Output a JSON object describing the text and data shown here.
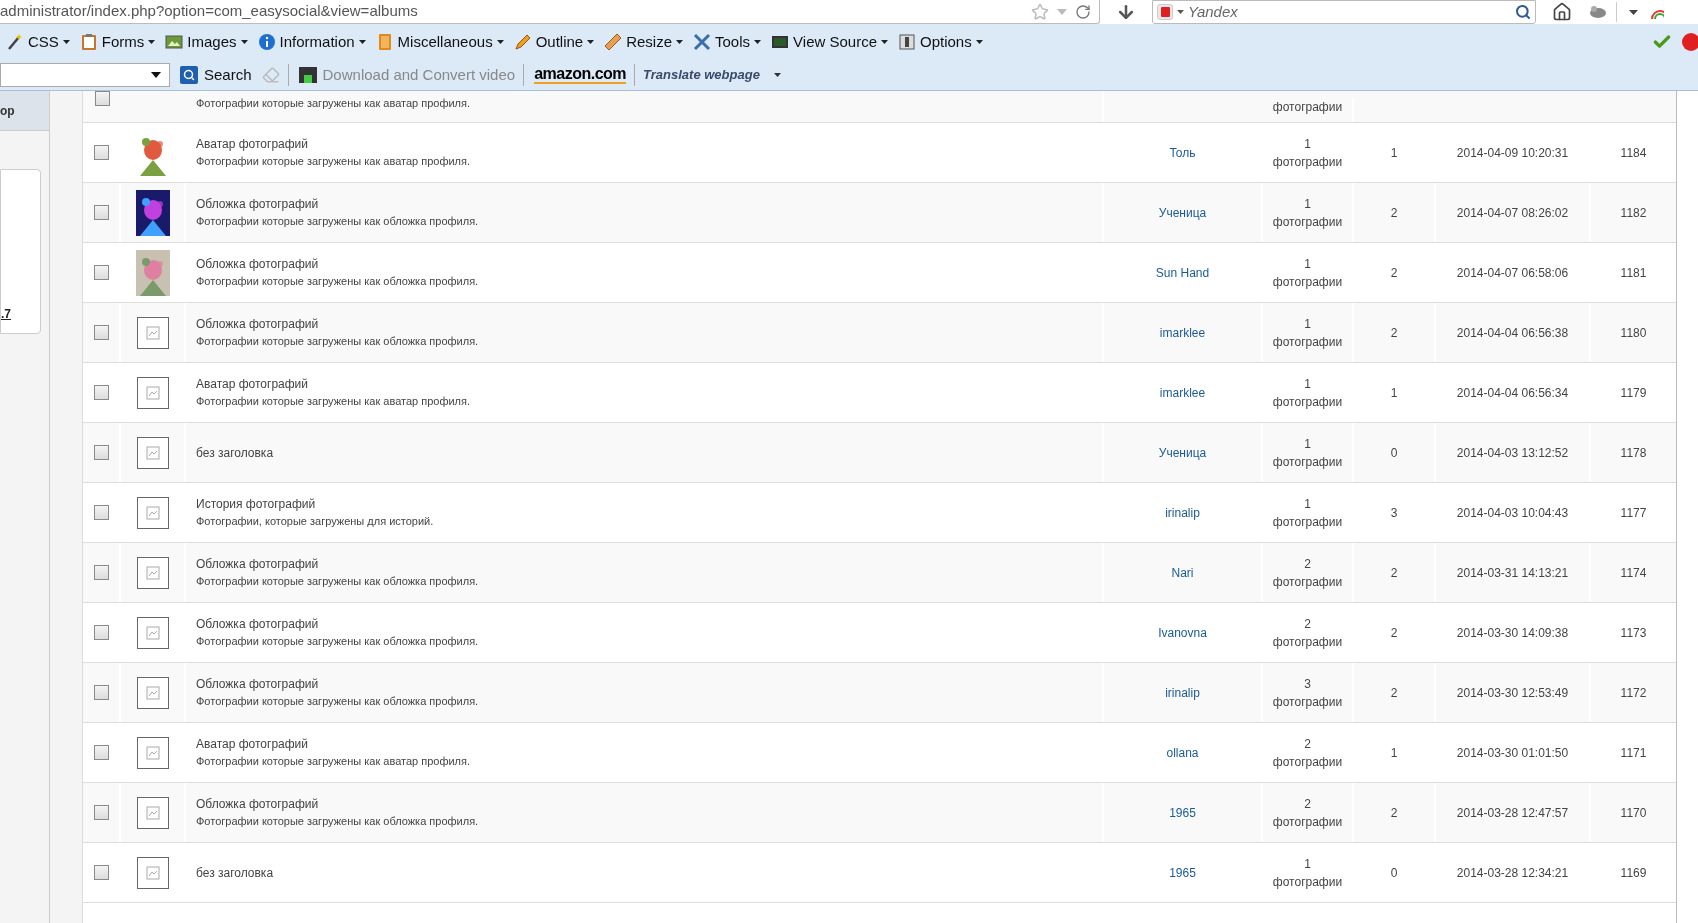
{
  "address_bar": {
    "url": "administrator/index.php?option=com_easysocial&view=albums"
  },
  "search_bar": {
    "placeholder": "Yandex"
  },
  "menu_toolbar": [
    {
      "label": "CSS"
    },
    {
      "label": "Forms"
    },
    {
      "label": "Images"
    },
    {
      "label": "Information"
    },
    {
      "label": "Miscellaneous"
    },
    {
      "label": "Outline"
    },
    {
      "label": "Resize"
    },
    {
      "label": "Tools"
    },
    {
      "label": "View Source"
    },
    {
      "label": "Options"
    }
  ],
  "second_toolbar": {
    "search_button": "Search",
    "download": {
      "label": "Download and Convert video",
      "disabled": true
    },
    "amazon": "amazon.com",
    "translate": "Translate webpage"
  },
  "sidebar": {
    "heading": "op",
    "link": ".7"
  },
  "albums": {
    "partial_row": {
      "checked": false,
      "description": "Фотографии которые загружены как аватар профиля.",
      "photos_label": "фотографии"
    },
    "rows": [
      {
        "checked": false,
        "kind": "picture",
        "title": "Аватар фотографий",
        "description": "Фотографии которые загружены как аватар профиля.",
        "author": "Толь",
        "photos_count": "1",
        "photos_label": "фотографии",
        "count": "1",
        "date": "2014-04-09 10:20:31",
        "id": "1184"
      },
      {
        "checked": false,
        "kind": "picture",
        "title": "Обложка фотографий",
        "description": "Фотографии которые загружены как обложка профиля.",
        "author": "Ученица",
        "photos_count": "1",
        "photos_label": "фотографии",
        "count": "2",
        "date": "2014-04-07 08:26:02",
        "id": "1182"
      },
      {
        "checked": false,
        "kind": "picture",
        "title": "Обложка фотографий",
        "description": "Фотографии которые загружены как обложка профиля.",
        "author": "Sun Hand",
        "photos_count": "1",
        "photos_label": "фотографии",
        "count": "2",
        "date": "2014-04-07 06:58:06",
        "id": "1181"
      },
      {
        "checked": false,
        "kind": "placeholder",
        "title": "Обложка фотографий",
        "description": "Фотографии которые загружены как обложка профиля.",
        "author": "imarklee",
        "photos_count": "1",
        "photos_label": "фотографии",
        "count": "2",
        "date": "2014-04-04 06:56:38",
        "id": "1180"
      },
      {
        "checked": false,
        "kind": "placeholder",
        "title": "Аватар фотографий",
        "description": "Фотографии которые загружены как аватар профиля.",
        "author": "imarklee",
        "photos_count": "1",
        "photos_label": "фотографии",
        "count": "1",
        "date": "2014-04-04 06:56:34",
        "id": "1179"
      },
      {
        "checked": false,
        "kind": "placeholder",
        "title": "без заголовка",
        "author": "Ученица",
        "photos_count": "1",
        "photos_label": "фотографии",
        "count": "0",
        "date": "2014-04-03 13:12:52",
        "id": "1178"
      },
      {
        "checked": false,
        "kind": "placeholder",
        "title": "История фотографий",
        "description": "Фотографии, которые загружены для историй.",
        "author": "irinalip",
        "photos_count": "1",
        "photos_label": "фотографии",
        "count": "3",
        "date": "2014-04-03 10:04:43",
        "id": "1177"
      },
      {
        "checked": false,
        "kind": "placeholder",
        "title": "Обложка фотографий",
        "description": "Фотографии которые загружены как обложка профиля.",
        "author": "Nari",
        "photos_count": "2",
        "photos_label": "фотографии",
        "count": "2",
        "date": "2014-03-31 14:13:21",
        "id": "1174"
      },
      {
        "checked": false,
        "kind": "placeholder",
        "title": "Обложка фотографий",
        "description": "Фотографии которые загружены как обложка профиля.",
        "author": "Ivanovna",
        "photos_count": "2",
        "photos_label": "фотографии",
        "count": "2",
        "date": "2014-03-30 14:09:38",
        "id": "1173"
      },
      {
        "checked": false,
        "kind": "placeholder",
        "title": "Обложка фотографий",
        "description": "Фотографии которые загружены как обложка профиля.",
        "author": "irinalip",
        "photos_count": "3",
        "photos_label": "фотографии",
        "count": "2",
        "date": "2014-03-30 12:53:49",
        "id": "1172"
      },
      {
        "checked": false,
        "kind": "placeholder",
        "title": "Аватар фотографий",
        "description": "Фотографии которые загружены как аватар профиля.",
        "author": "ollana",
        "photos_count": "2",
        "photos_label": "фотографии",
        "count": "1",
        "date": "2014-03-30 01:01:50",
        "id": "1171"
      },
      {
        "checked": false,
        "kind": "placeholder",
        "title": "Обложка фотографий",
        "description": "Фотографии которые загружены как обложка профиля.",
        "author": "1965",
        "photos_count": "2",
        "photos_label": "фотографии",
        "count": "2",
        "date": "2014-03-28 12:47:57",
        "id": "1170"
      },
      {
        "checked": false,
        "kind": "placeholder",
        "title": "без заголовка",
        "author": "1965",
        "photos_count": "1",
        "photos_label": "фотографии",
        "count": "0",
        "date": "2014-03-28 12:34:21",
        "id": "1169"
      }
    ]
  }
}
